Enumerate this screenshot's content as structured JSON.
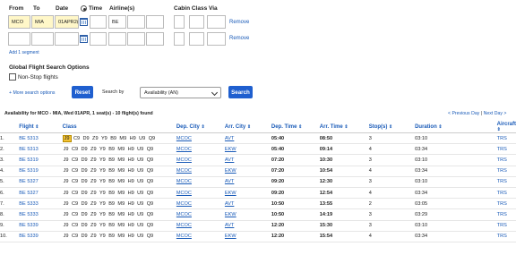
{
  "header": {
    "from": "From",
    "to": "To",
    "date": "Date",
    "time": "Time",
    "airlines": "Airline(s)",
    "cabin_class_via": "Cabin Class Via"
  },
  "segment1": {
    "from": "MCO",
    "to": "MIA",
    "date": "01APR2(",
    "airline": "BE",
    "remove": "Remove"
  },
  "segment2": {
    "remove": "Remove"
  },
  "add_segment": "Add 1 segment",
  "options": {
    "title": "Global Flight Search Options",
    "nonstop": "Non-Stop flights",
    "more": "More search options",
    "reset": "Reset",
    "search_by_label": "Search by",
    "search_by_value": "Availability (AN)",
    "search": "Search"
  },
  "results": {
    "summary": "Availability for MCO - MIA, Wed 01APR, 1 seat(s) - 10 flight(s) found",
    "prev_day": "< Previous Day",
    "next_day": "Next Day >",
    "sep": "|",
    "columns": [
      "Flight",
      "Class",
      "Dep. City",
      "Arr. City",
      "Dep. Time",
      "Arr. Time",
      "Stop(s)",
      "Duration",
      "Aircraft"
    ],
    "rows": [
      {
        "n": "1.",
        "flight": "BE 5313",
        "classes": [
          "J9",
          "C9",
          "D9",
          "Z9",
          "Y9",
          "B9",
          "M9",
          "H9",
          "U9",
          "Q9"
        ],
        "dep": "MCOC",
        "arr": "AVT",
        "dt": "05:40",
        "at": "08:50",
        "stops": "3",
        "dur": "03:10",
        "ac": "TRS"
      },
      {
        "n": "2.",
        "flight": "BE 5313",
        "classes": [
          "J9",
          "C9",
          "D9",
          "Z9",
          "Y9",
          "B9",
          "M9",
          "H9",
          "U9",
          "Q9"
        ],
        "dep": "MCOC",
        "arr": "EKW",
        "dt": "05:40",
        "at": "09:14",
        "stops": "4",
        "dur": "03:34",
        "ac": "TRS"
      },
      {
        "n": "3.",
        "flight": "BE 5319",
        "classes": [
          "J9",
          "C9",
          "D9",
          "Z9",
          "Y9",
          "B9",
          "M9",
          "H9",
          "U9",
          "Q9"
        ],
        "dep": "MCOC",
        "arr": "AVT",
        "dt": "07:20",
        "at": "10:30",
        "stops": "3",
        "dur": "03:10",
        "ac": "TRS"
      },
      {
        "n": "4.",
        "flight": "BE 5319",
        "classes": [
          "J9",
          "C9",
          "D9",
          "Z9",
          "Y9",
          "B9",
          "M9",
          "H9",
          "U9",
          "Q9"
        ],
        "dep": "MCOC",
        "arr": "EKW",
        "dt": "07:20",
        "at": "10:54",
        "stops": "4",
        "dur": "03:34",
        "ac": "TRS"
      },
      {
        "n": "5.",
        "flight": "BE 5327",
        "classes": [
          "J9",
          "C9",
          "D9",
          "Z9",
          "Y9",
          "B9",
          "M9",
          "H9",
          "U9",
          "Q9"
        ],
        "dep": "MCOC",
        "arr": "AVT",
        "dt": "09:20",
        "at": "12:30",
        "stops": "3",
        "dur": "03:10",
        "ac": "TRS"
      },
      {
        "n": "6.",
        "flight": "BE 5327",
        "classes": [
          "J9",
          "C9",
          "D9",
          "Z9",
          "Y9",
          "B9",
          "M9",
          "H9",
          "U9",
          "Q9"
        ],
        "dep": "MCOC",
        "arr": "EKW",
        "dt": "09:20",
        "at": "12:54",
        "stops": "4",
        "dur": "03:34",
        "ac": "TRS"
      },
      {
        "n": "7.",
        "flight": "BE 5333",
        "classes": [
          "J9",
          "C9",
          "D9",
          "Z9",
          "Y9",
          "B9",
          "M9",
          "H9",
          "U9",
          "Q9"
        ],
        "dep": "MCOC",
        "arr": "AVT",
        "dt": "10:50",
        "at": "13:55",
        "stops": "2",
        "dur": "03:05",
        "ac": "TRS"
      },
      {
        "n": "8.",
        "flight": "BE 5333",
        "classes": [
          "J9",
          "C9",
          "D9",
          "Z9",
          "Y9",
          "B9",
          "M9",
          "H9",
          "U9",
          "Q9"
        ],
        "dep": "MCOC",
        "arr": "EKW",
        "dt": "10:50",
        "at": "14:19",
        "stops": "3",
        "dur": "03:29",
        "ac": "TRS"
      },
      {
        "n": "9.",
        "flight": "BE 5339",
        "classes": [
          "J9",
          "C9",
          "D9",
          "Z9",
          "Y9",
          "B9",
          "M9",
          "H9",
          "U9",
          "Q9"
        ],
        "dep": "MCOC",
        "arr": "AVT",
        "dt": "12:20",
        "at": "15:30",
        "stops": "3",
        "dur": "03:10",
        "ac": "TRS"
      },
      {
        "n": "10.",
        "flight": "BE 5339",
        "classes": [
          "J9",
          "C9",
          "D9",
          "Z9",
          "Y9",
          "B9",
          "M9",
          "H9",
          "U9",
          "Q9"
        ],
        "dep": "MCOC",
        "arr": "EKW",
        "dt": "12:20",
        "at": "15:54",
        "stops": "4",
        "dur": "03:34",
        "ac": "TRS"
      }
    ]
  },
  "colors": {
    "link": "#1a5bb8",
    "button": "#1f5fcf",
    "highlight": "#f3c233"
  }
}
